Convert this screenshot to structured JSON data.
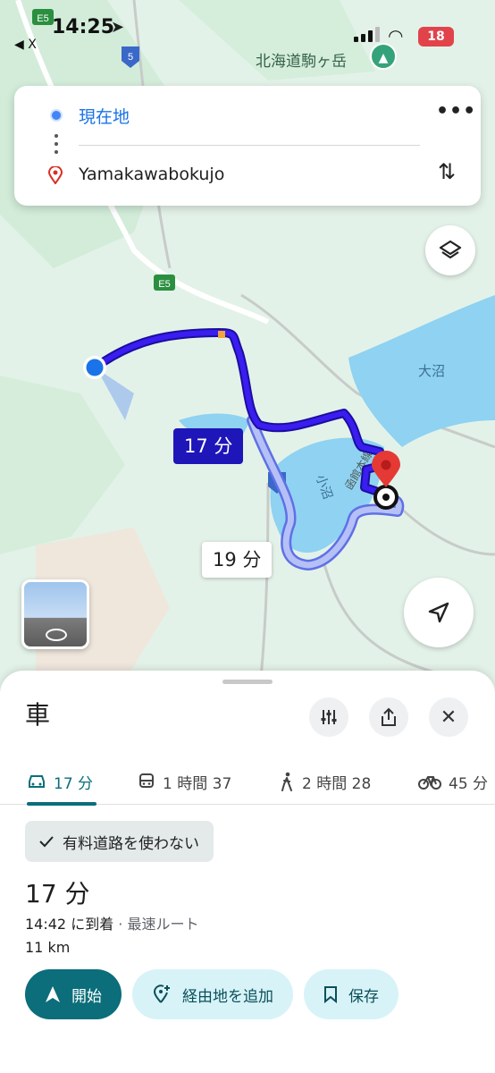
{
  "status_bar": {
    "time": "14:25",
    "back_label": "◀ X",
    "battery": "18"
  },
  "map": {
    "highway_label_e5": "E5",
    "road_label_5": "5",
    "poi_name": "北海道駒ヶ岳",
    "lake_onuma": "大沼",
    "lake_konuma": "小沼",
    "road_name": "函館本線"
  },
  "directions": {
    "origin": "現在地",
    "destination": "Yamakawabokujo"
  },
  "routes": {
    "main_chip": "17 分",
    "alt_chip": "19 分"
  },
  "sheet": {
    "mode_title": "車",
    "tabs": [
      {
        "label": "17 分",
        "icon": "car-icon"
      },
      {
        "label": "1 時間 37",
        "icon": "train-icon"
      },
      {
        "label": "2 時間 28",
        "icon": "walk-icon"
      },
      {
        "label": "45 分",
        "icon": "bike-icon"
      }
    ],
    "avoid_tolls": "有料道路を使わない",
    "duration": "17 分",
    "arrival": "14:42 に到着",
    "arrival_note": "· 最速ルート",
    "distance": "11 km",
    "actions": {
      "start": "開始",
      "add_stop": "経由地を追加",
      "save": "保存"
    }
  },
  "colors": {
    "accent": "#0b6e7a",
    "route_main": "#2a14c9",
    "route_alt": "#a6b2f5",
    "water": "#8fd2f2",
    "land": "#e6f3ea"
  }
}
